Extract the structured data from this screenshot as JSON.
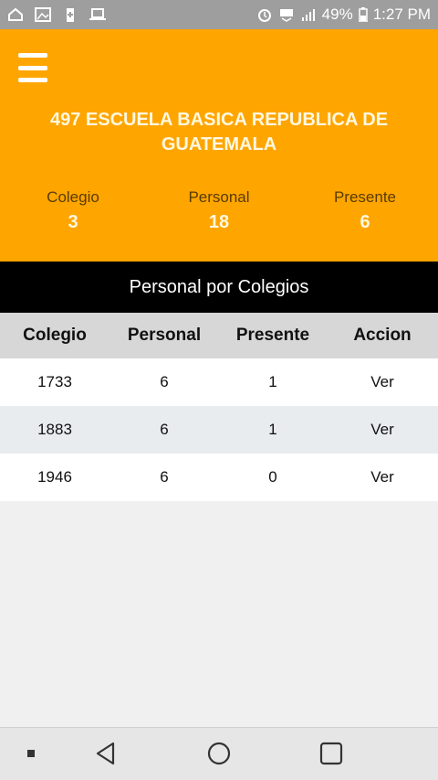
{
  "status_bar": {
    "battery": "49%",
    "time": "1:27 PM",
    "left_icons": [
      "sync-icon",
      "image-icon",
      "battery-saver-icon",
      "laptop-icon"
    ],
    "right_icons": [
      "alarm-icon",
      "lte-icon",
      "signal-icon",
      "battery-icon"
    ]
  },
  "header": {
    "title": "497 ESCUELA BASICA REPUBLICA DE GUATEMALA",
    "stats": [
      {
        "label": "Colegio",
        "value": "3"
      },
      {
        "label": "Personal",
        "value": "18"
      },
      {
        "label": "Presente",
        "value": "6"
      }
    ],
    "background_color": "#ffa500"
  },
  "section": {
    "title": "Personal por Colegios"
  },
  "table": {
    "columns": [
      "Colegio",
      "Personal",
      "Presente",
      "Accion"
    ],
    "rows": [
      {
        "colegio": "1733",
        "personal": "6",
        "presente": "1",
        "accion": "Ver"
      },
      {
        "colegio": "1883",
        "personal": "6",
        "presente": "1",
        "accion": "Ver"
      },
      {
        "colegio": "1946",
        "personal": "6",
        "presente": "0",
        "accion": "Ver"
      }
    ]
  },
  "nav": [
    "dot-icon",
    "back-icon",
    "home-icon",
    "recents-icon"
  ]
}
